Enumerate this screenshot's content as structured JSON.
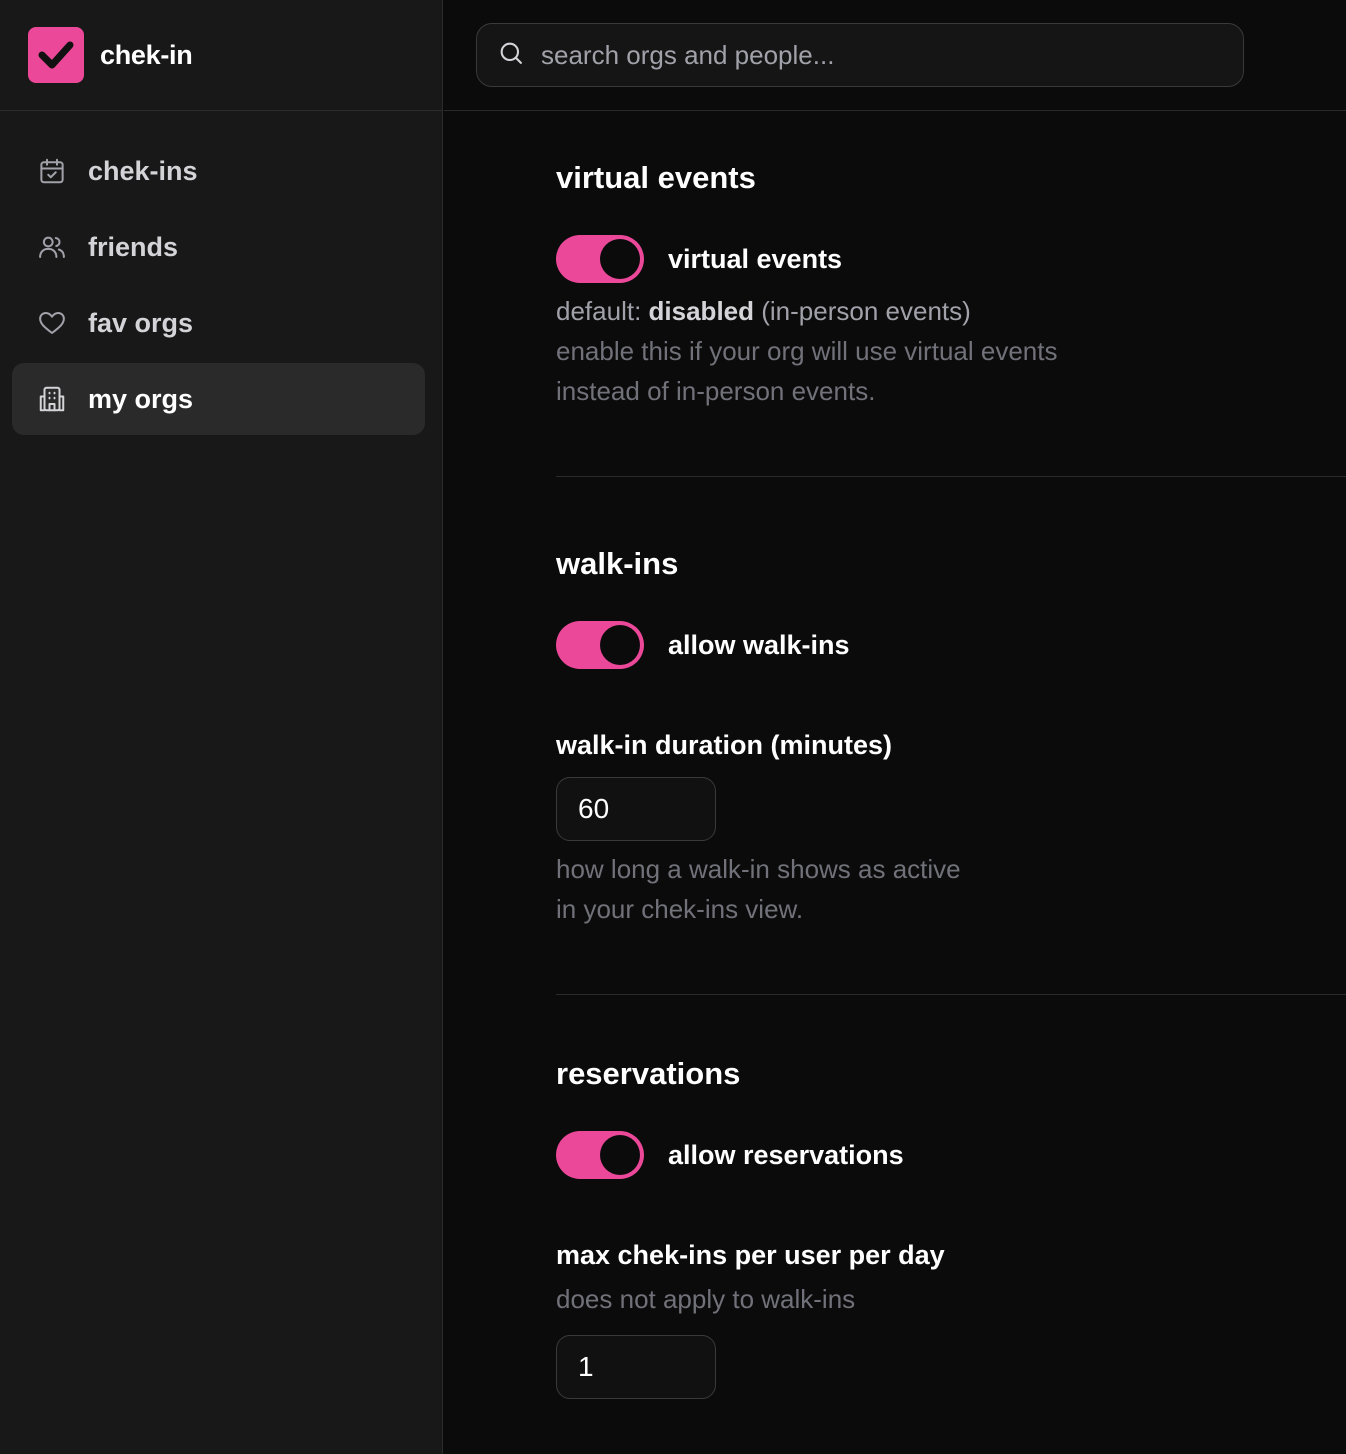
{
  "app": {
    "name": "chek-in",
    "accent_color": "#ec4899"
  },
  "sidebar": {
    "items": [
      {
        "label": "chek-ins",
        "icon": "calendar-check-icon",
        "active": false
      },
      {
        "label": "friends",
        "icon": "users-icon",
        "active": false
      },
      {
        "label": "fav orgs",
        "icon": "heart-icon",
        "active": false
      },
      {
        "label": "my orgs",
        "icon": "building-icon",
        "active": true
      }
    ]
  },
  "search": {
    "placeholder": "search orgs and people...",
    "value": ""
  },
  "sections": {
    "virtual": {
      "title": "virtual events",
      "toggle_label": "virtual events",
      "toggle_on": true,
      "default_prefix": "default:",
      "default_value": "disabled",
      "default_suffix": "(in-person events)",
      "help_line1": "enable this if your org will use virtual events",
      "help_line2": "instead of in-person events."
    },
    "walkins": {
      "title": "walk-ins",
      "toggle_label": "allow walk-ins",
      "toggle_on": true,
      "duration_label": "walk-in duration (minutes)",
      "duration_value": "60",
      "help_line1": "how long a walk-in shows as active",
      "help_line2": "in your chek-ins view."
    },
    "reservations": {
      "title": "reservations",
      "toggle_label": "allow reservations",
      "toggle_on": true,
      "max_label": "max chek-ins per user per day",
      "max_help": "does not apply to walk-ins",
      "max_value": "1"
    }
  }
}
